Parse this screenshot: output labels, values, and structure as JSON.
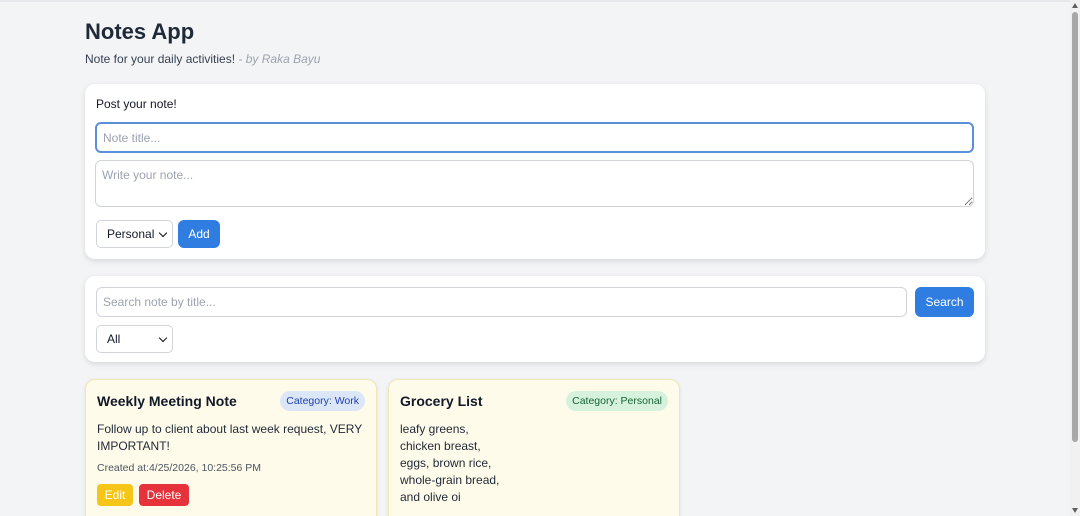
{
  "header": {
    "title": "Notes App",
    "subtitle": "Note for your daily activities!",
    "author": "- by Raka Bayu"
  },
  "post": {
    "label": "Post your note!",
    "title_placeholder": "Note title...",
    "body_placeholder": "Write your note...",
    "category_selected": "Personal",
    "add_label": "Add"
  },
  "search": {
    "placeholder": "Search note by title...",
    "button_label": "Search",
    "filter_selected": "All"
  },
  "notes": [
    {
      "title": "Weekly Meeting Note",
      "category": "Category: Work",
      "body_lines": [
        "Follow up to client about last week request, VERY",
        "IMPORTANT!"
      ],
      "created": "Created at:4/25/2026, 10:25:56 PM",
      "edit_label": "Edit",
      "delete_label": "Delete"
    },
    {
      "title": "Grocery List",
      "category": "Category: Personal",
      "body_lines": [
        "leafy greens,",
        "chicken breast,",
        "eggs, brown rice,",
        "whole-grain bread,",
        "and olive oi"
      ]
    }
  ],
  "colors": {
    "primary": "#2f7de1",
    "edit": "#f5c518",
    "delete": "#e5323b",
    "note_bg": "#fefbea"
  }
}
